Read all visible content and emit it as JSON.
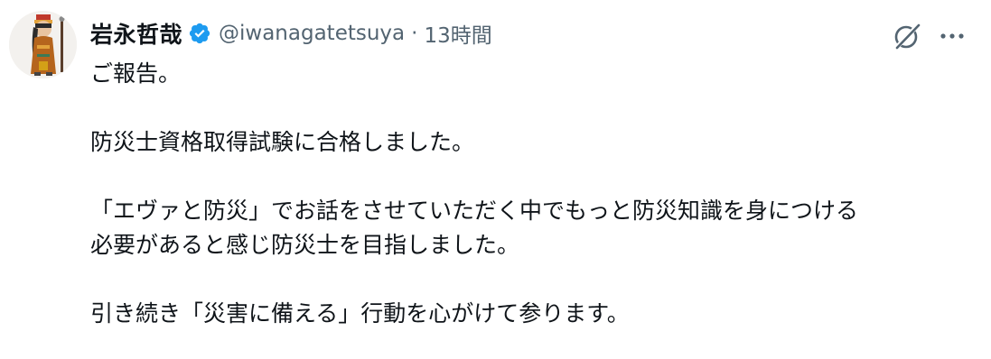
{
  "author": {
    "display_name": "岩永哲哉",
    "handle": "@iwanagatetsuya",
    "separator": "·",
    "timestamp": "13時間",
    "verified": true,
    "verified_color": "#1d9bf0"
  },
  "actions": {
    "grok_icon": "grok-icon",
    "more_icon": "more-icon"
  },
  "post": {
    "lines": [
      "ご報告。",
      "",
      "防災士資格取得試験に合格しました。",
      "",
      "「エヴァと防災」でお話をさせていただく中でもっと防災知識を身につける",
      "必要があると感じ防災士を目指しました。",
      "",
      "引き続き「災害に備える」行動を心がけて参ります。"
    ]
  },
  "colors": {
    "text_primary": "#0f1419",
    "text_secondary": "#536471",
    "background": "#ffffff"
  }
}
